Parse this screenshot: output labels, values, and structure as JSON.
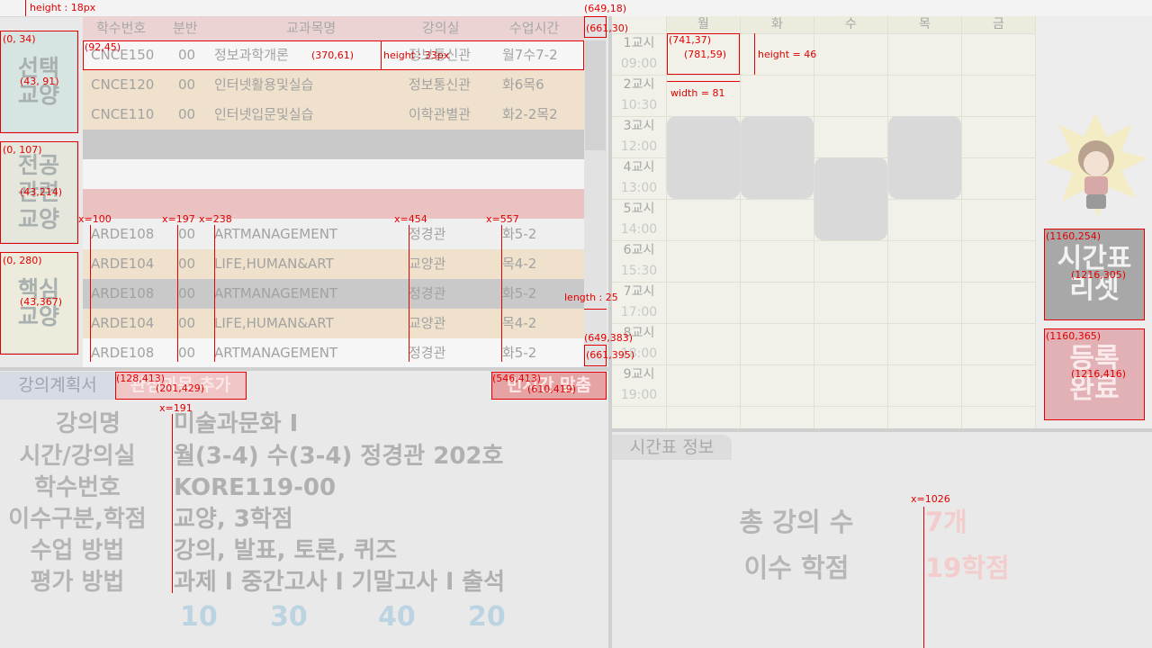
{
  "annotations": {
    "height_18": "height : 18px",
    "c649_18": "(649,18)",
    "c661_30": "(661,30)",
    "c0_34": "(0, 34)",
    "c43_91": "(43, 91)",
    "c92_45": "(92,45)",
    "c370_61": "(370,61)",
    "height_33": "height : 33px",
    "c0_107": "(0, 107)",
    "c43_214": "(43,214)",
    "c0_280": "(0, 280)",
    "c43_367": "(43,367)",
    "x100": "x=100",
    "x197": "x=197",
    "x238": "x=238",
    "x454": "x=454",
    "x557": "x=557",
    "length25": "length : 25",
    "c649_383": "(649,383)",
    "c661_395": "(661,395)",
    "c128_413": "(128,413)",
    "c201_429": "(201,429)",
    "c546_413": "(546,413)",
    "c610_419": "(610,419)",
    "x191": "x=191",
    "c741_37": "(741,37)",
    "c781_59": "(781,59)",
    "height46": "height = 46",
    "width81": "width = 81",
    "c1160_254": "(1160,254)",
    "c1216_305": "(1216,305)",
    "c1160_365": "(1160,365)",
    "c1216_416": "(1216,416)",
    "x1026": "x=1026"
  },
  "categories": {
    "liberal": "선택\n교양",
    "major": "전공\n관련\n교양",
    "core": "핵심\n교양"
  },
  "table": {
    "headers": [
      "학수번호",
      "분반",
      "교과목명",
      "강의실",
      "수업시간"
    ],
    "rows": [
      {
        "code": "CNCE150",
        "section": "00",
        "name": "정보과학개론",
        "room": "정보통신관",
        "time": "월7수7-2"
      },
      {
        "code": "CNCE120",
        "section": "00",
        "name": "인터넷활용및실습",
        "room": "정보통신관",
        "time": "화6목6"
      },
      {
        "code": "CNCE110",
        "section": "00",
        "name": "인터넷입문및실습",
        "room": "이학관별관",
        "time": "화2-2목2"
      },
      {
        "code": "ARDE108",
        "section": "00",
        "name": "ARTMANAGEMENT",
        "room": "정경관",
        "time": "화5-2"
      },
      {
        "code": "ARDE104",
        "section": "00",
        "name": "LIFE,HUMAN&ART",
        "room": "교양관",
        "time": "목4-2"
      },
      {
        "code": "ARDE108",
        "section": "00",
        "name": "ARTMANAGEMENT",
        "room": "정경관",
        "time": "화5-2"
      },
      {
        "code": "ARDE104",
        "section": "00",
        "name": "LIFE,HUMAN&ART",
        "room": "교양관",
        "time": "목4-2"
      },
      {
        "code": "ARDE108",
        "section": "00",
        "name": "ARTMANAGEMENT",
        "room": "정경관",
        "time": "화5-2"
      }
    ]
  },
  "tabs": {
    "plan": "강의계획서",
    "add": "관심과목 추가",
    "fit": "빈시간 맞춤"
  },
  "details": {
    "labels": [
      "강의명",
      "시간/강의실",
      "학수번호",
      "이수구분,학점",
      "수업 방법",
      "평가 방법"
    ],
    "values": [
      "미술과문화 I",
      "월(3-4) 수(3-4) 정경관 202호",
      "KORE119-00",
      "교양, 3학점",
      "강의, 발표, 토론, 퀴즈",
      "과제 l 중간고사 l 기말고사 l 출석"
    ],
    "weights": [
      "10",
      "30",
      "40",
      "20"
    ]
  },
  "timetable": {
    "days": [
      "월",
      "화",
      "수",
      "목",
      "금"
    ],
    "periods": [
      "1교시",
      "2교시",
      "3교시",
      "4교시",
      "5교시",
      "6교시",
      "7교시",
      "8교시",
      "9교시"
    ],
    "times": [
      "09:00",
      "10:30",
      "12:00",
      "13:00",
      "14:00",
      "15:30",
      "17:00",
      "18:00",
      "19:00"
    ]
  },
  "buttons": {
    "reset": "시간표\n리셋",
    "done": "등록\n완료"
  },
  "summary": {
    "tab": "시간표 정보",
    "count_label": "총 강의 수",
    "count_value": "7개",
    "credit_label": "이수 학점",
    "credit_value": "19학점"
  }
}
